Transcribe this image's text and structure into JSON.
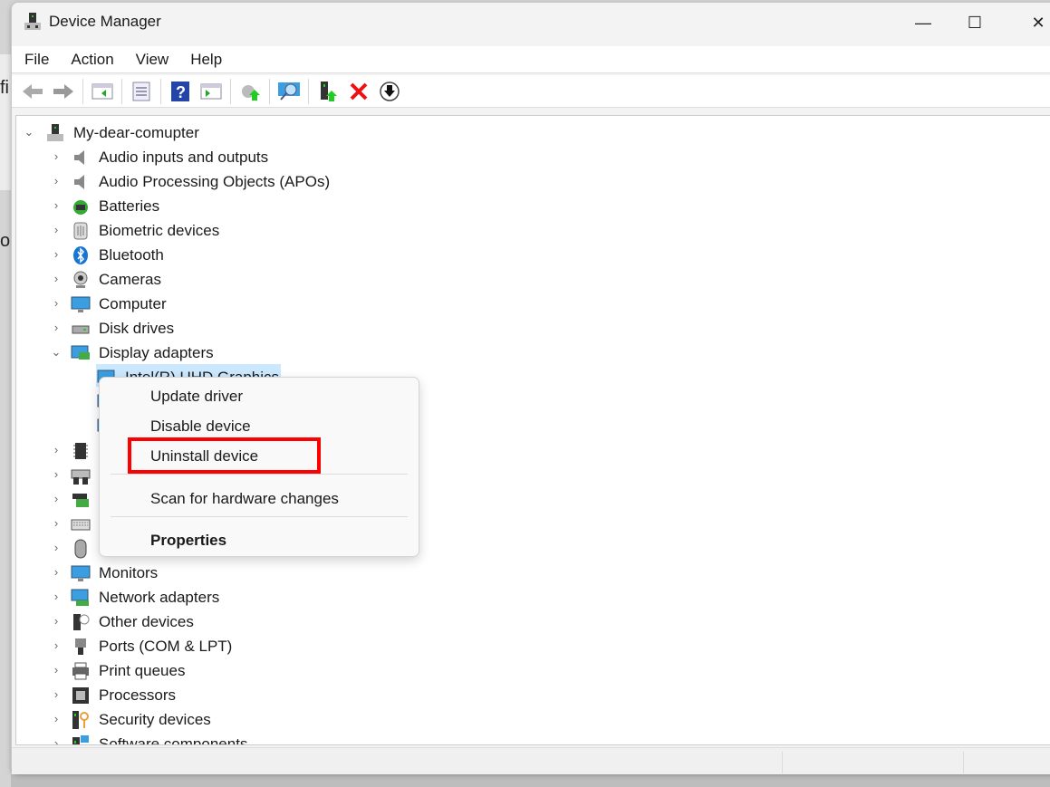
{
  "background_fragments": [
    "fi",
    "o"
  ],
  "window": {
    "title": "Device Manager",
    "minimize": "—",
    "maximize": "☐",
    "close": "✕"
  },
  "menu": [
    "File",
    "Action",
    "View",
    "Help"
  ],
  "toolbar": [
    "back-icon",
    "forward-icon",
    "show-hide-console-tree-icon",
    "properties-icon",
    "help-icon",
    "show-hide-action-pane-icon",
    "update-driver-icon",
    "scan-hardware-icon",
    "enable-device-icon",
    "uninstall-device-icon",
    "disable-device-icon"
  ],
  "tree": {
    "root": "My-dear-comupter",
    "categories": [
      "Audio inputs and outputs",
      "Audio Processing Objects (APOs)",
      "Batteries",
      "Biometric devices",
      "Bluetooth",
      "Cameras",
      "Computer",
      "Disk drives",
      "Display adapters"
    ],
    "selected_child": "Intel(R) UHD Graphics",
    "categories_after": [
      "Monitors",
      "Network adapters",
      "Other devices",
      "Ports (COM & LPT)",
      "Print queues",
      "Processors",
      "Security devices",
      "Software components"
    ]
  },
  "context_menu": {
    "items": [
      "Update driver",
      "Disable device",
      "Uninstall device",
      "Scan for hardware changes",
      "Properties"
    ],
    "highlighted": "Uninstall device",
    "highlight_color": "#ff0000"
  },
  "colors": {
    "selection": "#cce8ff",
    "accent": "#0078d4"
  }
}
